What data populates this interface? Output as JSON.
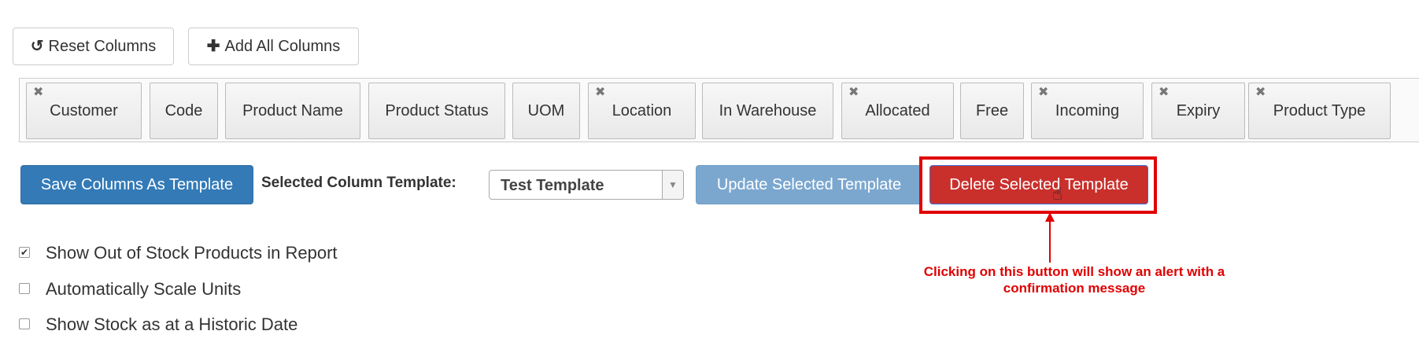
{
  "toolbar": {
    "reset_label": "Reset Columns",
    "add_all_label": "Add All Columns"
  },
  "columns": [
    {
      "label": "Customer",
      "removable": true
    },
    {
      "label": "Code",
      "removable": false
    },
    {
      "label": "Product Name",
      "removable": false
    },
    {
      "label": "Product Status",
      "removable": false
    },
    {
      "label": "UOM",
      "removable": false
    },
    {
      "label": "Location",
      "removable": true
    },
    {
      "label": "In Warehouse",
      "removable": false
    },
    {
      "label": "Allocated",
      "removable": true
    },
    {
      "label": "Free",
      "removable": false
    },
    {
      "label": "Incoming",
      "removable": true
    },
    {
      "label": "Expiry",
      "removable": true
    },
    {
      "label": "Product Type",
      "removable": true
    }
  ],
  "template": {
    "save_label": "Save Columns As Template",
    "selected_label": "Selected Column Template:",
    "selected_value": "Test Template",
    "update_label": "Update Selected Template",
    "delete_label": "Delete Selected Template"
  },
  "annotation": {
    "text": "Clicking on this button will show an alert with a confirmation message"
  },
  "options": [
    {
      "label": "Show Out of Stock Products in Report",
      "checked": true
    },
    {
      "label": "Automatically Scale Units",
      "checked": false
    },
    {
      "label": "Show Stock as at a Historic Date",
      "checked": false
    }
  ],
  "colors": {
    "primary": "#2e6da4",
    "primary_disabled": "#7ba7cf",
    "danger": "#c9302c",
    "annotation": "#e00000"
  },
  "icons": {
    "reset": "undo-icon",
    "add": "plus-icon",
    "remove": "close-icon",
    "dropdown": "chevron-down-icon",
    "cursor": "hand-pointer-icon"
  }
}
